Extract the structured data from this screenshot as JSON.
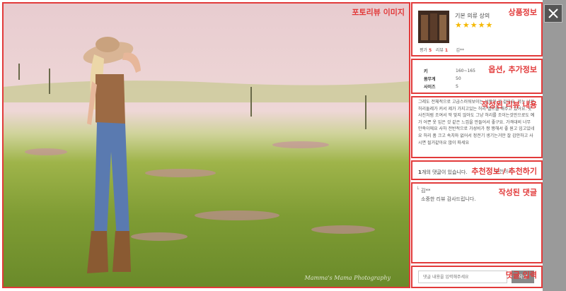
{
  "photo_panel": {
    "label": "포토리뷰 이미지",
    "watermark": "Mamma's Mama Photography"
  },
  "product": {
    "label": "상품정보",
    "name": "기본 의류 상의",
    "stars": "★★★★★",
    "rating_label": "평가",
    "rating_value": "5",
    "review_label": "리뷰",
    "review_value": "1",
    "author": "김**"
  },
  "options": {
    "label": "옵션, 추가정보",
    "rows": [
      {
        "key": "키",
        "value": "160~165"
      },
      {
        "key": "몸무게",
        "value": "50"
      },
      {
        "key": "사이즈",
        "value": "S"
      }
    ]
  },
  "review": {
    "label": "작성된 리뷰 내용",
    "text": "그레도 전체적으로 고급스러워보이는 상품인 것 같아요. 저는 너무 허리둘레가 커서 제가 가지고있는 허리 벨트를 해주고 있어요. 옷 사진처럼 조여서 딱 맞지 않아도 그냥 허리를 조이는것만으로도 예가 어쁜 옷 입은 것 같은 느낌을 만들어서 좋구요. 가격대비 너무 만족이에요 사하 전반적으로 가성비가 짱 짱해서 좋 원고 입고있네요 허리 품 크고 속치마 없어서 정전기 생기는거만 잘 감안하고 사시면 될거같아요 많이 파세요"
  },
  "recommend": {
    "label": "추천정보 / 추천하기",
    "count": "1",
    "text_suffix": "개의 댓글이 있습니다.",
    "button": "추천하기"
  },
  "comments": {
    "label": "작성된 댓글",
    "items": [
      {
        "author": "김**",
        "text": "소중한 리뷰 감사드립니다."
      }
    ]
  },
  "comment_input": {
    "label": "댓글 입력",
    "placeholder": "댓글 내용을 입력해주세요",
    "submit": "작성"
  },
  "close_icon": "close-icon",
  "colors": {
    "annotation": "#e23a3a",
    "stars": "#f5b800",
    "overlay": "#9a9a9a"
  }
}
